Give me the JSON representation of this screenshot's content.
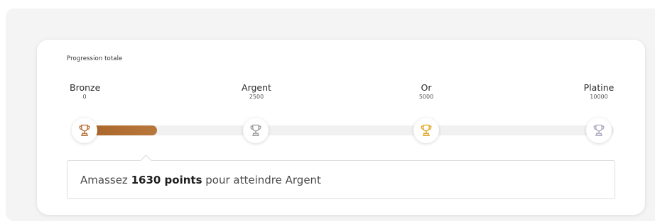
{
  "progress": {
    "title": "Progression totale",
    "current_points": 870,
    "max_points": 10000,
    "tiers": [
      {
        "name": "Bronze",
        "points": "0",
        "color": "#b06a2c",
        "icon": "trophy-icon"
      },
      {
        "name": "Argent",
        "points": "2500",
        "color": "#9a9a9a",
        "icon": "trophy-icon"
      },
      {
        "name": "Or",
        "points": "5000",
        "color": "#e0a51e",
        "icon": "trophy-icon"
      },
      {
        "name": "Platine",
        "points": "10000",
        "color": "#a9a9bf",
        "icon": "trophy-icon"
      }
    ],
    "bar_fill_color": "#b8773c",
    "track_color": "#f1f1f1"
  },
  "message": {
    "prefix": "Amassez ",
    "highlight": "1630 points",
    "suffix": " pour atteindre Argent"
  }
}
